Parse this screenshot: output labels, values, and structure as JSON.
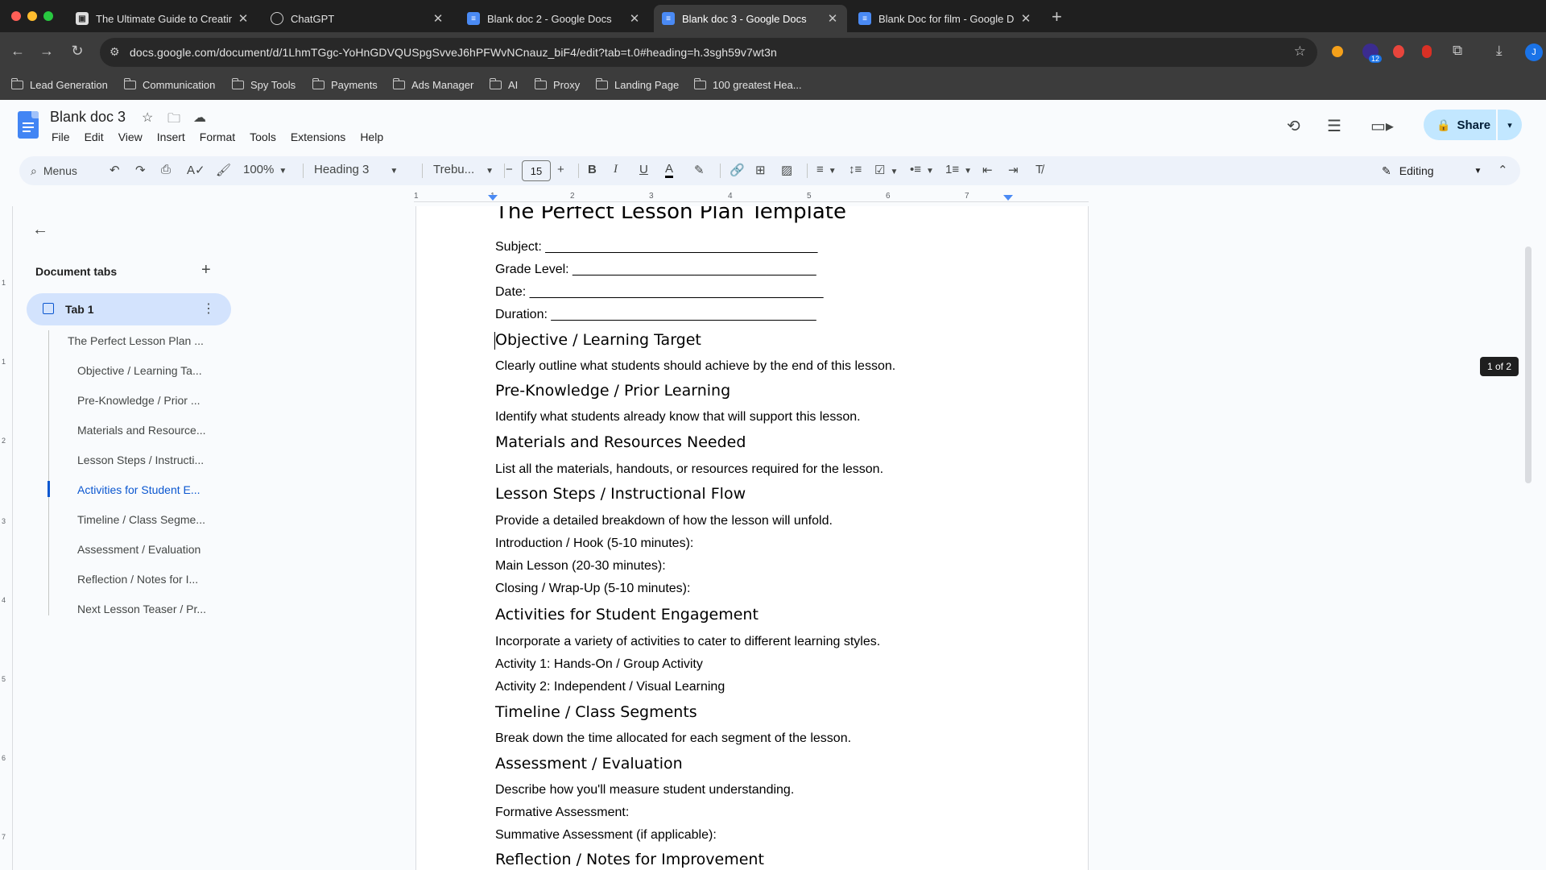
{
  "browser": {
    "tabs": [
      {
        "title": "The Ultimate Guide to Creatin",
        "icon": "generic-icon",
        "active": false
      },
      {
        "title": "ChatGPT",
        "icon": "chatgpt-icon",
        "active": false
      },
      {
        "title": "Blank doc 2 - Google Docs",
        "icon": "docs-icon",
        "active": false
      },
      {
        "title": "Blank doc 3 - Google Docs",
        "icon": "docs-icon",
        "active": true
      },
      {
        "title": "Blank Doc for film - Google D",
        "icon": "docs-icon",
        "active": false
      }
    ],
    "url": "docs.google.com/document/d/1LhmTGgc-YoHnGDVQUSpgSvveJ6hPFWvNCnauz_biF4/edit?tab=t.0#heading=h.3sgh59v7wt3n",
    "extension_badge": "12",
    "profile_initial": "J",
    "bookmarks": [
      "Lead Generation",
      "Communication",
      "Spy Tools",
      "Payments",
      "Ads Manager",
      "AI",
      "Proxy",
      "Landing Page",
      "100 greatest Hea..."
    ]
  },
  "docs": {
    "title": "Blank doc 3",
    "menu": [
      "File",
      "Edit",
      "View",
      "Insert",
      "Format",
      "Tools",
      "Extensions",
      "Help"
    ],
    "share_label": "Share",
    "toolbar": {
      "search_label": "Menus",
      "zoom": "100%",
      "style": "Heading 3",
      "font": "Trebu...",
      "font_size": "15",
      "mode": "Editing"
    },
    "sidebar": {
      "heading": "Document tabs",
      "tab_label": "Tab 1",
      "outline": [
        "The Perfect Lesson Plan ...",
        "Objective / Learning Ta...",
        "Pre-Knowledge / Prior ...",
        "Materials and Resource...",
        "Lesson Steps / Instructi...",
        "Activities for Student E...",
        "Timeline / Class Segme...",
        "Assessment / Evaluation",
        "Reflection / Notes for I...",
        "Next Lesson Teaser / Pr..."
      ],
      "active_index": 5
    },
    "ruler_numbers": [
      "1",
      "1",
      "2",
      "3",
      "4",
      "5",
      "6",
      "7"
    ],
    "vruler_numbers": [
      "1",
      "1",
      "2",
      "3",
      "4",
      "5",
      "6",
      "7",
      "8"
    ],
    "page_badge": "1 of 2",
    "content": [
      {
        "type": "h1",
        "text": "The Perfect Lesson Plan Template"
      },
      {
        "type": "p",
        "text": "Subject: ______________________________________"
      },
      {
        "type": "p",
        "text": "Grade Level: __________________________________"
      },
      {
        "type": "p",
        "text": "Date: _________________________________________"
      },
      {
        "type": "p",
        "text": "Duration: _____________________________________"
      },
      {
        "type": "h3",
        "text": "Objective / Learning Target"
      },
      {
        "type": "p",
        "text": "Clearly outline what students should achieve by the end of this lesson."
      },
      {
        "type": "h3",
        "text": "Pre-Knowledge / Prior Learning"
      },
      {
        "type": "p",
        "text": "Identify what students already know that will support this lesson."
      },
      {
        "type": "h3",
        "text": "Materials and Resources Needed"
      },
      {
        "type": "p",
        "text": "List all the materials, handouts, or resources required for the lesson."
      },
      {
        "type": "h3",
        "text": "Lesson Steps / Instructional Flow"
      },
      {
        "type": "p",
        "text": "Provide a detailed breakdown of how the lesson will unfold."
      },
      {
        "type": "p",
        "text": "Introduction / Hook (5-10 minutes):"
      },
      {
        "type": "p",
        "text": "Main Lesson (20-30 minutes):"
      },
      {
        "type": "p",
        "text": "Closing / Wrap-Up (5-10 minutes):"
      },
      {
        "type": "h3",
        "text": "Activities for Student Engagement"
      },
      {
        "type": "p",
        "text": "Incorporate a variety of activities to cater to different learning styles."
      },
      {
        "type": "p",
        "text": "Activity 1: Hands-On / Group Activity"
      },
      {
        "type": "p",
        "text": "Activity 2: Independent / Visual Learning"
      },
      {
        "type": "h3",
        "text": "Timeline / Class Segments"
      },
      {
        "type": "p",
        "text": "Break down the time allocated for each segment of the lesson."
      },
      {
        "type": "h3",
        "text": "Assessment / Evaluation"
      },
      {
        "type": "p",
        "text": "Describe how you'll measure student understanding."
      },
      {
        "type": "p",
        "text": "Formative Assessment:"
      },
      {
        "type": "p",
        "text": "Summative Assessment (if applicable):"
      },
      {
        "type": "h3",
        "text": "Reflection / Notes for Improvement"
      }
    ]
  },
  "colors": {
    "accent": "#0b57d0",
    "share_bg": "#c2e7ff",
    "sidebar_selected": "#d3e3fd",
    "toolbar_bg": "#edf2fa",
    "chrome_dark": "#1f1f1f"
  }
}
